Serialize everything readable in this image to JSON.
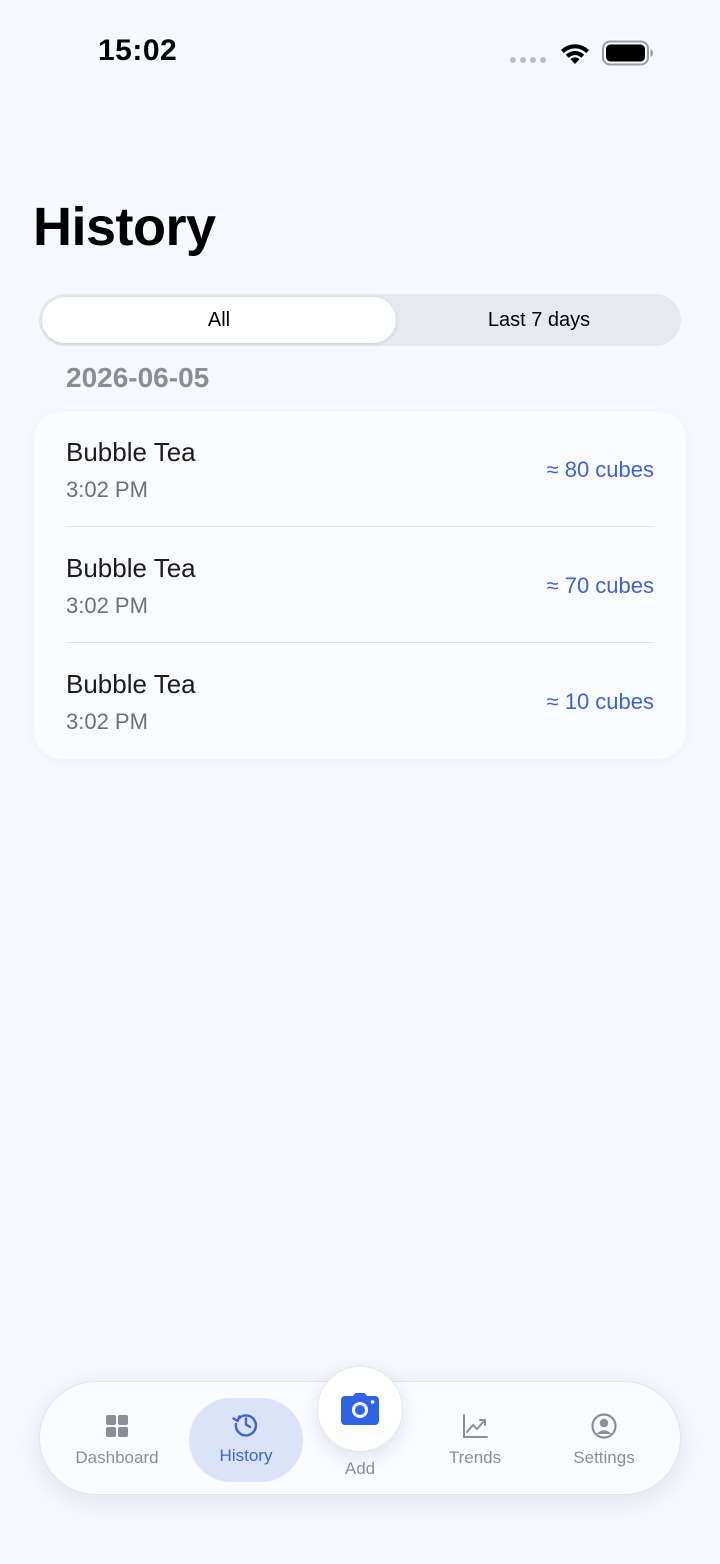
{
  "status_bar": {
    "time": "15:02"
  },
  "page": {
    "title": "History"
  },
  "filter": {
    "options": [
      "All",
      "Last 7 days"
    ],
    "selected": "All"
  },
  "sections": [
    {
      "date": "2026-06-05",
      "entries": [
        {
          "name": "Bubble Tea",
          "time": "3:02 PM",
          "amount": "≈ 80 cubes"
        },
        {
          "name": "Bubble Tea",
          "time": "3:02 PM",
          "amount": "≈ 70 cubes"
        },
        {
          "name": "Bubble Tea",
          "time": "3:02 PM",
          "amount": "≈ 10 cubes"
        }
      ]
    }
  ],
  "tabbar": {
    "tabs": [
      {
        "label": "Dashboard",
        "icon": "grid-icon"
      },
      {
        "label": "History",
        "icon": "history-clock-icon",
        "active": true
      },
      {
        "label": "Add",
        "icon": "camera-icon"
      },
      {
        "label": "Trends",
        "icon": "trend-chart-icon"
      },
      {
        "label": "Settings",
        "icon": "user-circle-icon"
      }
    ]
  },
  "colors": {
    "accent": "#3d63d6",
    "background": "#f5f8fc",
    "active_tab_bg": "#dbe3f8"
  }
}
